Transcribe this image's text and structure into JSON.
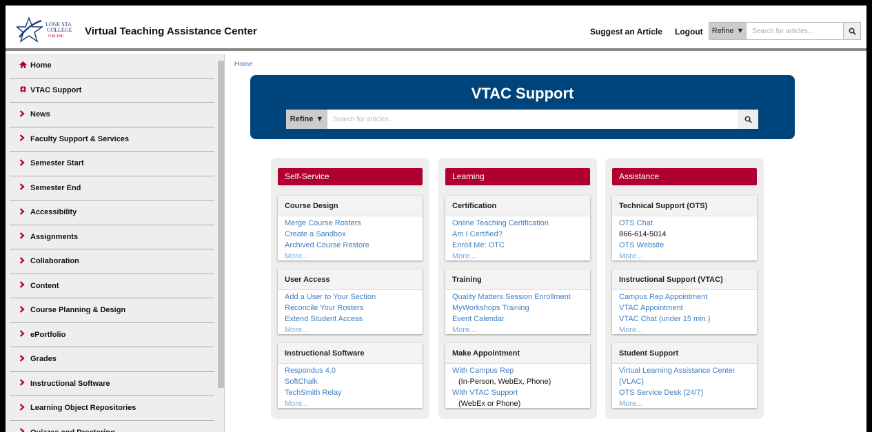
{
  "header": {
    "logo_text": [
      "LONE STAR",
      "COLLEGE",
      "ONLINE"
    ],
    "title": "Virtual Teaching Assistance Center",
    "suggest_label": "Suggest an Article",
    "logout_label": "Logout",
    "refine_label": "Refine",
    "search_placeholder": "Search for articles..."
  },
  "sidebar": {
    "items": [
      {
        "icon": "home-icon",
        "label": "Home"
      },
      {
        "icon": "lifebuoy-icon",
        "label": "VTAC Support"
      },
      {
        "icon": "chevron-right-icon",
        "label": "News"
      },
      {
        "icon": "chevron-right-icon",
        "label": "Faculty Support & Services"
      },
      {
        "icon": "chevron-right-icon",
        "label": "Semester Start"
      },
      {
        "icon": "chevron-right-icon",
        "label": "Semester End"
      },
      {
        "icon": "chevron-right-icon",
        "label": "Accessibility"
      },
      {
        "icon": "chevron-right-icon",
        "label": "Assignments"
      },
      {
        "icon": "chevron-right-icon",
        "label": "Collaboration"
      },
      {
        "icon": "chevron-right-icon",
        "label": "Content"
      },
      {
        "icon": "chevron-right-icon",
        "label": "Course Planning & Design"
      },
      {
        "icon": "chevron-right-icon",
        "label": "ePortfolio"
      },
      {
        "icon": "chevron-right-icon",
        "label": "Grades"
      },
      {
        "icon": "chevron-right-icon",
        "label": "Instructional Software"
      },
      {
        "icon": "chevron-right-icon",
        "label": "Learning Object Repositories"
      },
      {
        "icon": "chevron-right-icon",
        "label": "Quizzes and Proctoring"
      }
    ]
  },
  "breadcrumb": {
    "home": "Home"
  },
  "banner": {
    "title": "VTAC Support",
    "refine_label": "Refine",
    "search_placeholder": "Search for articles..."
  },
  "columns": [
    {
      "heading": "Self-Service",
      "cards": [
        {
          "title": "Course Design",
          "lines": [
            {
              "text": "Merge Course Rosters",
              "kind": "link"
            },
            {
              "text": "Create a Sandbox",
              "kind": "link"
            },
            {
              "text": "Archived Course Restore",
              "kind": "link"
            }
          ],
          "more": "More..."
        },
        {
          "title": "User Access",
          "lines": [
            {
              "text": "Add a User to Your Section",
              "kind": "link"
            },
            {
              "text": "Reconcile Your Rosters",
              "kind": "link"
            },
            {
              "text": "Extend Student Access",
              "kind": "link"
            }
          ],
          "more": "More..."
        },
        {
          "title": "Instructional Software",
          "lines": [
            {
              "text": "Respondus 4.0",
              "kind": "link"
            },
            {
              "text": "SoftChalk",
              "kind": "link"
            },
            {
              "text": "TechSmith Relay",
              "kind": "link"
            }
          ],
          "more": "More..."
        }
      ]
    },
    {
      "heading": "Learning",
      "cards": [
        {
          "title": "Certification",
          "lines": [
            {
              "text": "Online Teaching Certification",
              "kind": "link"
            },
            {
              "text": "Am I Certified?",
              "kind": "link"
            },
            {
              "text": "Enroll Me: OTC",
              "kind": "link"
            }
          ],
          "more": "More..."
        },
        {
          "title": "Training",
          "lines": [
            {
              "text": "Quality Matters Session Enrollment",
              "kind": "link"
            },
            {
              "text": "MyWorkshops Training",
              "kind": "link"
            },
            {
              "text": "Event Calendar",
              "kind": "link"
            }
          ],
          "more": "More..."
        },
        {
          "title": "Make Appointment",
          "lines": [
            {
              "text": "With Campus Rep",
              "kind": "link"
            },
            {
              "text": "(In-Person, WebEx, Phone)",
              "kind": "indent"
            },
            {
              "text": "With VTAC Support",
              "kind": "link"
            },
            {
              "text": "(WebEx or Phone)",
              "kind": "indent"
            }
          ],
          "more": ""
        }
      ]
    },
    {
      "heading": "Assistance",
      "cards": [
        {
          "title": "Technical Support (OTS)",
          "lines": [
            {
              "text": "OTS Chat",
              "kind": "link"
            },
            {
              "text": "866-614-5014",
              "kind": "text"
            },
            {
              "text": "OTS Website",
              "kind": "link"
            }
          ],
          "more": "More..."
        },
        {
          "title": "Instructional Support (VTAC)",
          "lines": [
            {
              "text": "Campus Rep Appointment",
              "kind": "link"
            },
            {
              "text": "VTAC Appointment",
              "kind": "link"
            },
            {
              "text": "VTAC Chat (under 15 min.)",
              "kind": "link"
            }
          ],
          "more": "More..."
        },
        {
          "title": "Student Support",
          "lines": [
            {
              "text": "Virtual Learning Assistance Center",
              "kind": "link"
            },
            {
              "text": "(VLAC)",
              "kind": "link"
            },
            {
              "text": "OTS Service Desk (24/7)",
              "kind": "link"
            }
          ],
          "more": "More..."
        }
      ]
    }
  ]
}
